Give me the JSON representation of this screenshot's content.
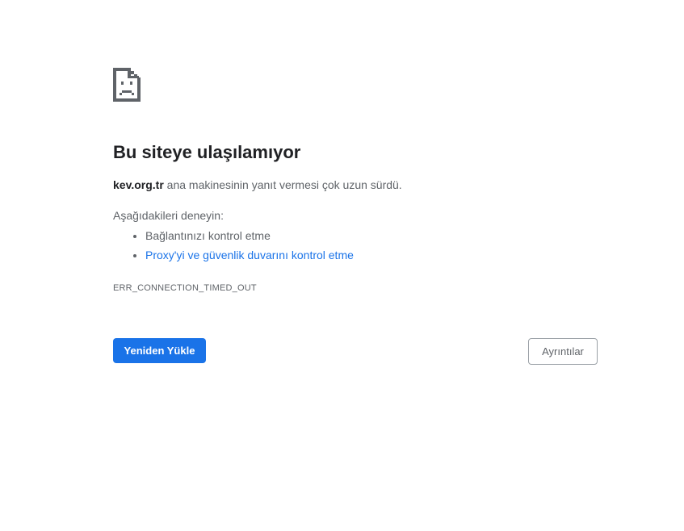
{
  "error_page": {
    "title": "Bu siteye ulaşılamıyor",
    "host": "kev.org.tr",
    "summary_rest": " ana makinesinin yanıt vermesi çok uzun sürdü.",
    "suggestions_label": "Aşağıdakileri deneyin:",
    "suggestions": [
      "Bağlantınızı kontrol etme",
      "Proxy'yi ve güvenlik duvarını kontrol etme"
    ],
    "error_code": "ERR_CONNECTION_TIMED_OUT",
    "reload_label": "Yeniden Yükle",
    "details_label": "Ayrıntılar",
    "icon": "sad-page-icon",
    "link_color": "#1a73e8",
    "button_color": "#1a73e8"
  }
}
